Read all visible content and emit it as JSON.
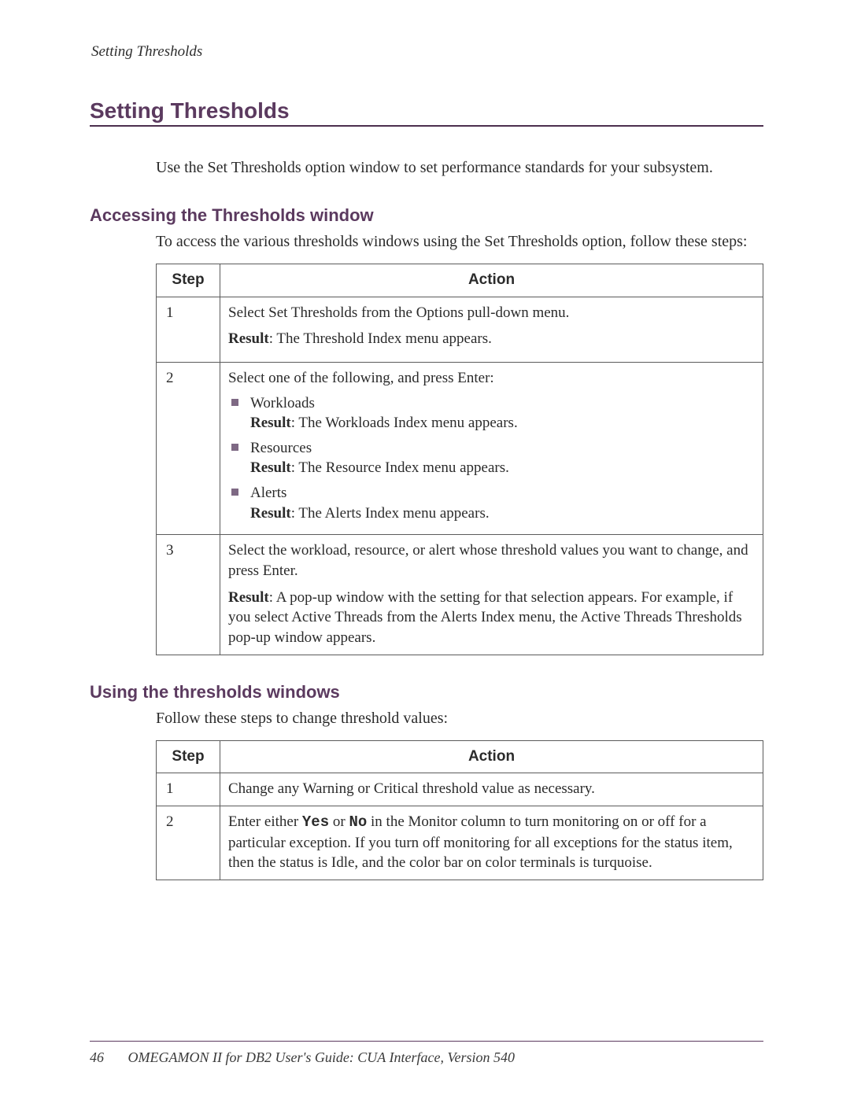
{
  "runningHead": "Setting Thresholds",
  "pageTitle": "Setting Thresholds",
  "intro": "Use the Set Thresholds option window to set performance standards for your subsystem.",
  "section1": {
    "heading": "Accessing the Thresholds window",
    "lead": "To access the various thresholds windows using the Set Thresholds option, follow these steps:",
    "headerStep": "Step",
    "headerAction": "Action",
    "resultLabel": "Result",
    "row1": {
      "step": "1",
      "action": "Select Set Thresholds from the Options pull-down menu.",
      "result": ": The Threshold Index menu appears."
    },
    "row2": {
      "step": "2",
      "action": "Select one of the following, and press Enter:",
      "items": {
        "a": {
          "title": "Workloads",
          "result": ": The Workloads Index menu appears."
        },
        "b": {
          "title": "Resources",
          "result": ": The Resource Index menu appears."
        },
        "c": {
          "title": "Alerts",
          "result": ": The Alerts Index menu appears."
        }
      }
    },
    "row3": {
      "step": "3",
      "action": "Select the workload, resource, or alert whose threshold values you want to change, and press Enter.",
      "result": ": A pop-up window with the setting for that selection appears. For example, if you select Active Threads from the Alerts Index menu, the Active Threads Thresholds pop-up window appears."
    }
  },
  "section2": {
    "heading": "Using the thresholds windows",
    "lead": "Follow these steps to change threshold values:",
    "headerStep": "Step",
    "headerAction": "Action",
    "row1": {
      "step": "1",
      "action": "Change any Warning or Critical threshold value as necessary."
    },
    "row2": {
      "step": "2",
      "action_pre": "Enter either ",
      "yes": "Yes",
      "or": " or ",
      "no": "No",
      "action_post": " in the Monitor column to turn monitoring on or off for a particular exception. If you turn off monitoring for all exceptions for the status item, then the status is Idle, and the color bar on color terminals is turquoise."
    }
  },
  "footer": {
    "pageNumber": "46",
    "title": "OMEGAMON II for DB2 User's Guide: CUA Interface, Version 540"
  }
}
